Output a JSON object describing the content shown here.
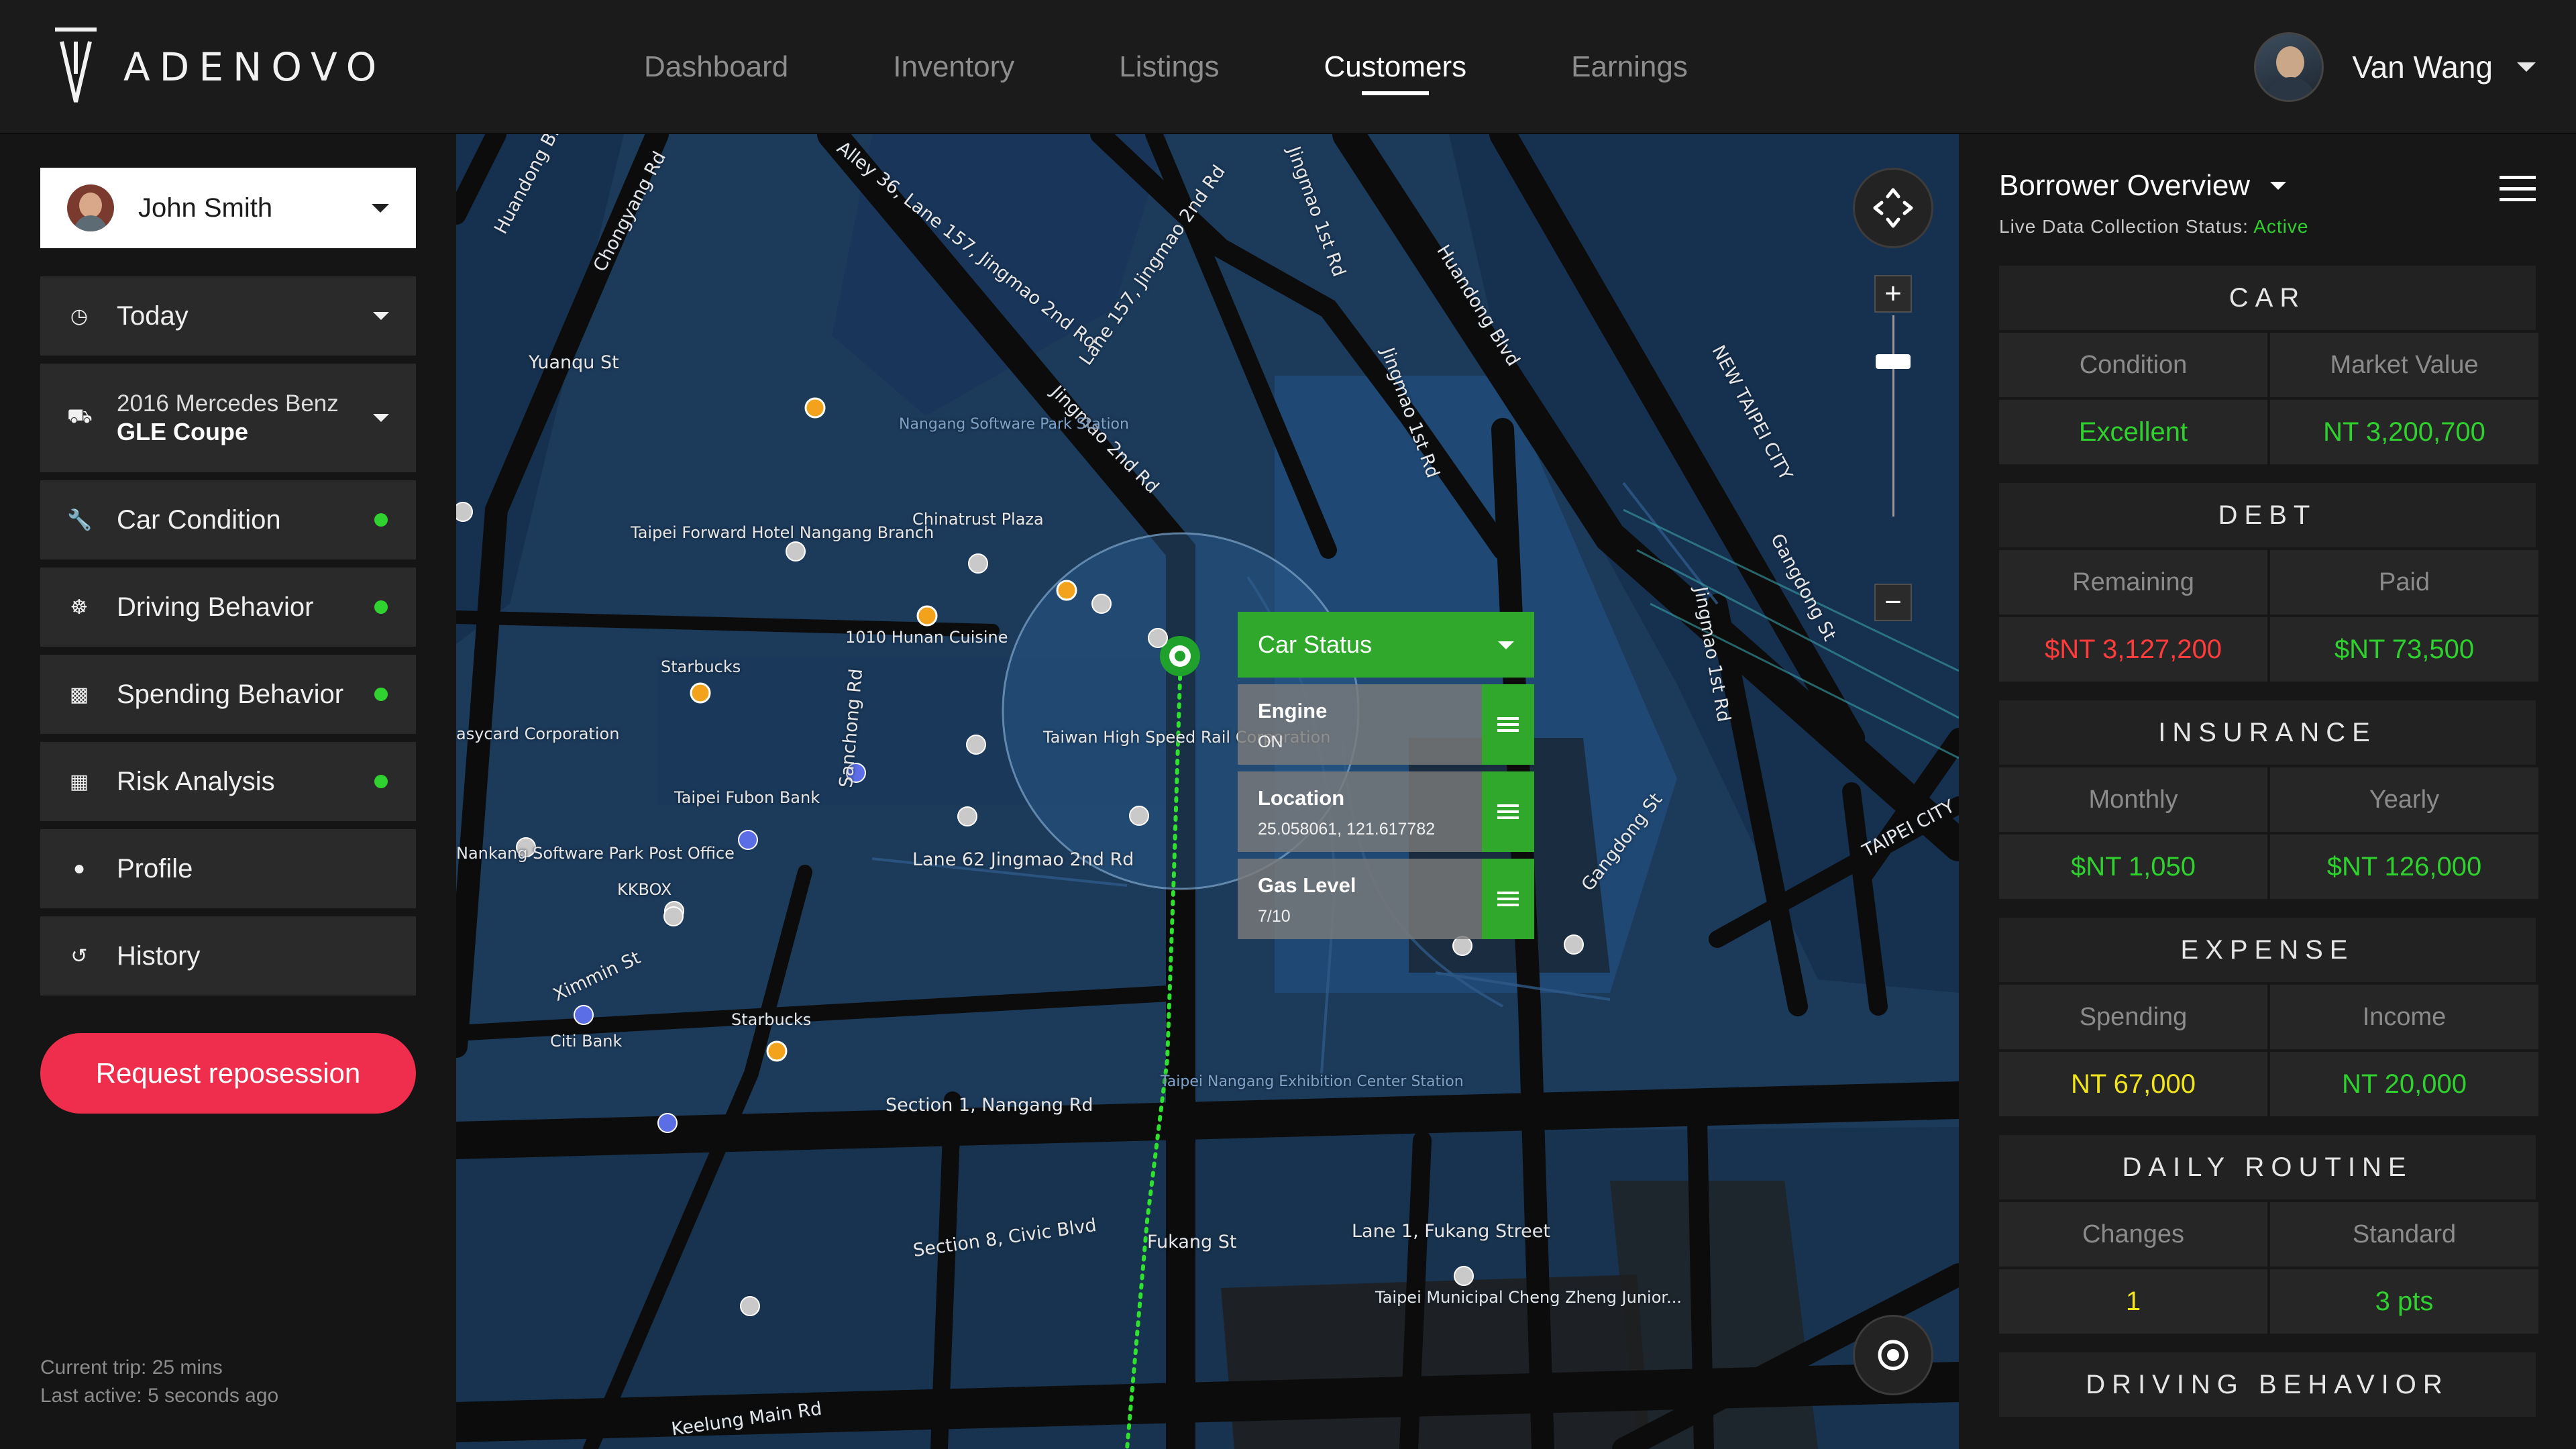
{
  "app": {
    "brand": "ADENOVO",
    "nav": [
      {
        "label": "Dashboard",
        "active": false
      },
      {
        "label": "Inventory",
        "active": false
      },
      {
        "label": "Listings",
        "active": false
      },
      {
        "label": "Customers",
        "active": true
      },
      {
        "label": "Earnings",
        "active": false
      }
    ],
    "user_name": "Van Wang"
  },
  "sidebar": {
    "customer": "John Smith",
    "today": "Today",
    "car_line1": "2016 Mercedes Benz",
    "car_line2": "GLE Coupe",
    "items": [
      {
        "label": "Car Condition",
        "icon": "wrench-icon",
        "status_dot": true
      },
      {
        "label": "Driving Behavior",
        "icon": "steering-wheel-icon",
        "status_dot": true
      },
      {
        "label": "Spending Behavior",
        "icon": "cash-icon",
        "status_dot": true
      },
      {
        "label": "Risk Analysis",
        "icon": "calculator-icon",
        "status_dot": true
      },
      {
        "label": "Profile",
        "icon": "person-icon",
        "status_dot": false
      },
      {
        "label": "History",
        "icon": "history-icon",
        "status_dot": false
      }
    ],
    "repossession_button": "Request reposession",
    "current_trip": "Current trip: 25 mins",
    "last_active": "Last active: 5 seconds ago",
    "status_dot_color": "#30d230",
    "accent_red": "#ee2e4c"
  },
  "map": {
    "labels": {
      "huandong_blvd": "Huandong Blvd",
      "huandong_blvd_2": "Huandong Blvd",
      "jingmao_1st": "Jingmao 1st Rd",
      "jingmao_1st_2": "Jingmao 1st Rd",
      "jingmao_2nd": "Jingmao 2nd Rd",
      "lane_157": "Lane 157, Jingmao 2nd Rd",
      "alley_36": "Alley 36, Lane 157, Jingmao 2nd Rd",
      "chongyang": "Chongyang Rd",
      "gangdong": "Gangdong St",
      "gangdong_2": "Gangdong St",
      "nangang": "Section 1, Nangang Rd",
      "civic": "Section 8, Civic Blvd",
      "fukang_st": "Fukang St",
      "fukang_lane": "Lane 1, Fukang Street",
      "yuanqu": "Yuanqu St",
      "sanchong": "Sanchong Rd",
      "xinmin": "Ximmin St",
      "lane62": "Lane 62 Jingmao 2nd Rd",
      "taipei_forward": "Taipei Forward Hotel Nangang Branch",
      "chinatrust": "Chinatrust Plaza",
      "starbucks1": "Starbucks",
      "starbucks2": "Starbucks",
      "hunan": "1010 Hunan Cuisine",
      "thsr": "Taiwan High Speed Rail Corporation",
      "fubon": "Taipei Fubon Bank",
      "easycard": "asycard Corporation",
      "nankang_soft": "Nankang Software Park Post Office",
      "kkbox": "KKBOX",
      "citibank": "Citi Bank",
      "school": "Taipei Municipal Cheng Zheng Junior...",
      "new_taipei": "NEW TAIPEI CITY",
      "taipei_city": "TAIPEI CITY",
      "keelung": "Keelung Main Rd",
      "nangang_park": "Nangang Software Park Station",
      "exhibit": "Taipei Nangang Exhibition Center Station"
    },
    "car_status": {
      "header": "Car Status",
      "rows": [
        {
          "title": "Engine",
          "value": "ON"
        },
        {
          "title": "Location",
          "value": "25.058061, 121.617782"
        },
        {
          "title": "Gas Level",
          "value": "7/10"
        }
      ]
    }
  },
  "panel": {
    "title": "Borrower Overview",
    "status_label": "Live Data Collection Status: ",
    "status_value": "Active",
    "sections": [
      {
        "name": "CAR",
        "left_label": "Condition",
        "right_label": "Market Value",
        "left_value": "Excellent",
        "right_value": "NT 3,200,700",
        "left_color": "green",
        "right_color": "green"
      },
      {
        "name": "DEBT",
        "left_label": "Remaining",
        "right_label": "Paid",
        "left_value": "$NT 3,127,200",
        "right_value": "$NT 73,500",
        "left_color": "red",
        "right_color": "green"
      },
      {
        "name": "INSURANCE",
        "left_label": "Monthly",
        "right_label": "Yearly",
        "left_value": "$NT 1,050",
        "right_value": "$NT 126,000",
        "left_color": "green",
        "right_color": "green"
      },
      {
        "name": "EXPENSE",
        "left_label": "Spending",
        "right_label": "Income",
        "left_value": "NT 67,000",
        "right_value": "NT 20,000",
        "left_color": "yellow",
        "right_color": "green"
      },
      {
        "name": "DAILY ROUTINE",
        "left_label": "Changes",
        "right_label": "Standard",
        "left_value": "1",
        "right_value": "3 pts",
        "left_color": "yellow",
        "right_color": "green"
      },
      {
        "name": "DRIVING BEHAVIOR"
      }
    ],
    "colors": {
      "green": "#2fd12f",
      "red": "#ff3b3b",
      "yellow": "#f2e51b"
    }
  }
}
